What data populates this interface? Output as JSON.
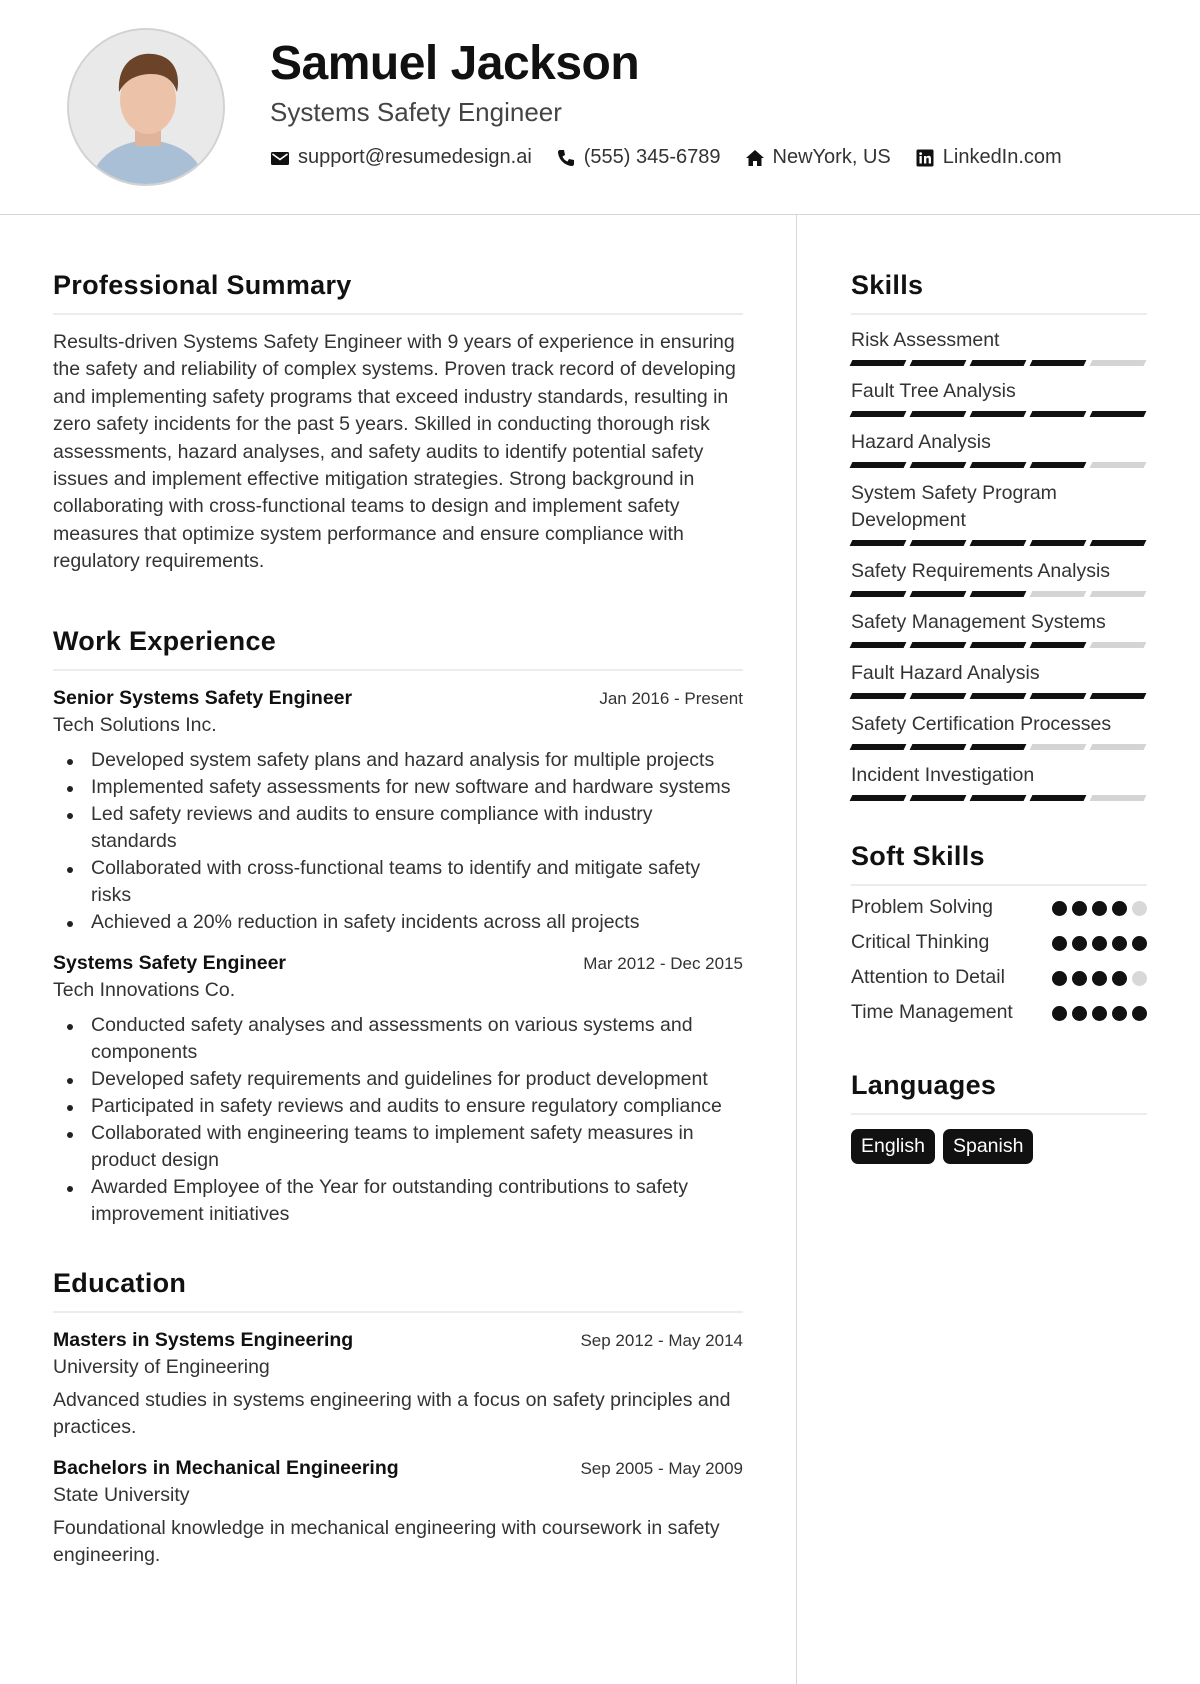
{
  "header": {
    "name": "Samuel Jackson",
    "title": "Systems Safety Engineer",
    "contacts": [
      {
        "icon": "envelope-icon",
        "text": "support@resumedesign.ai"
      },
      {
        "icon": "phone-icon",
        "text": "(555) 345-6789"
      },
      {
        "icon": "home-icon",
        "text": "NewYork, US"
      },
      {
        "icon": "linkedin-icon",
        "text": "LinkedIn.com"
      }
    ]
  },
  "summary": {
    "heading": "Professional Summary",
    "text": "Results-driven Systems Safety Engineer with 9 years of experience in ensuring the safety and reliability of complex systems. Proven track record of developing and implementing safety programs that exceed industry standards, resulting in zero safety incidents for the past 5 years. Skilled in conducting thorough risk assessments, hazard analyses, and safety audits to identify potential safety issues and implement effective mitigation strategies. Strong background in collaborating with cross-functional teams to design and implement safety measures that optimize system performance and ensure compliance with regulatory requirements."
  },
  "experience": {
    "heading": "Work Experience",
    "jobs": [
      {
        "title": "Senior Systems Safety Engineer",
        "dates": "Jan 2016 - Present",
        "org": "Tech Solutions Inc.",
        "bullets": [
          "Developed system safety plans and hazard analysis for multiple projects",
          "Implemented safety assessments for new software and hardware systems",
          "Led safety reviews and audits to ensure compliance with industry standards",
          "Collaborated with cross-functional teams to identify and mitigate safety risks",
          "Achieved a 20% reduction in safety incidents across all projects"
        ]
      },
      {
        "title": "Systems Safety Engineer",
        "dates": "Mar 2012 - Dec 2015",
        "org": "Tech Innovations Co.",
        "bullets": [
          "Conducted safety analyses and assessments on various systems and components",
          "Developed safety requirements and guidelines for product development",
          "Participated in safety reviews and audits to ensure regulatory compliance",
          "Collaborated with engineering teams to implement safety measures in product design",
          "Awarded Employee of the Year for outstanding contributions to safety improvement initiatives"
        ]
      }
    ]
  },
  "education": {
    "heading": "Education",
    "items": [
      {
        "degree": "Masters in Systems Engineering",
        "dates": "Sep 2012 - May 2014",
        "school": "University of Engineering",
        "desc": "Advanced studies in systems engineering with a focus on safety principles and practices."
      },
      {
        "degree": "Bachelors in Mechanical Engineering",
        "dates": "Sep 2005 - May 2009",
        "school": "State University",
        "desc": "Foundational knowledge in mechanical engineering with coursework in safety engineering."
      }
    ]
  },
  "skills": {
    "heading": "Skills",
    "max": 5,
    "items": [
      {
        "name": "Risk Assessment",
        "level": 4
      },
      {
        "name": "Fault Tree Analysis",
        "level": 5
      },
      {
        "name": "Hazard Analysis",
        "level": 4
      },
      {
        "name": "System Safety Program Development",
        "level": 5
      },
      {
        "name": "Safety Requirements Analysis",
        "level": 3
      },
      {
        "name": "Safety Management Systems",
        "level": 4
      },
      {
        "name": "Fault Hazard Analysis",
        "level": 5
      },
      {
        "name": "Safety Certification Processes",
        "level": 3
      },
      {
        "name": "Incident Investigation",
        "level": 4
      }
    ]
  },
  "soft_skills": {
    "heading": "Soft Skills",
    "max": 5,
    "items": [
      {
        "name": "Problem Solving",
        "level": 4
      },
      {
        "name": "Critical Thinking",
        "level": 5
      },
      {
        "name": "Attention to Detail",
        "level": 4
      },
      {
        "name": "Time Management",
        "level": 5
      }
    ]
  },
  "languages": {
    "heading": "Languages",
    "items": [
      "English",
      "Spanish"
    ]
  }
}
